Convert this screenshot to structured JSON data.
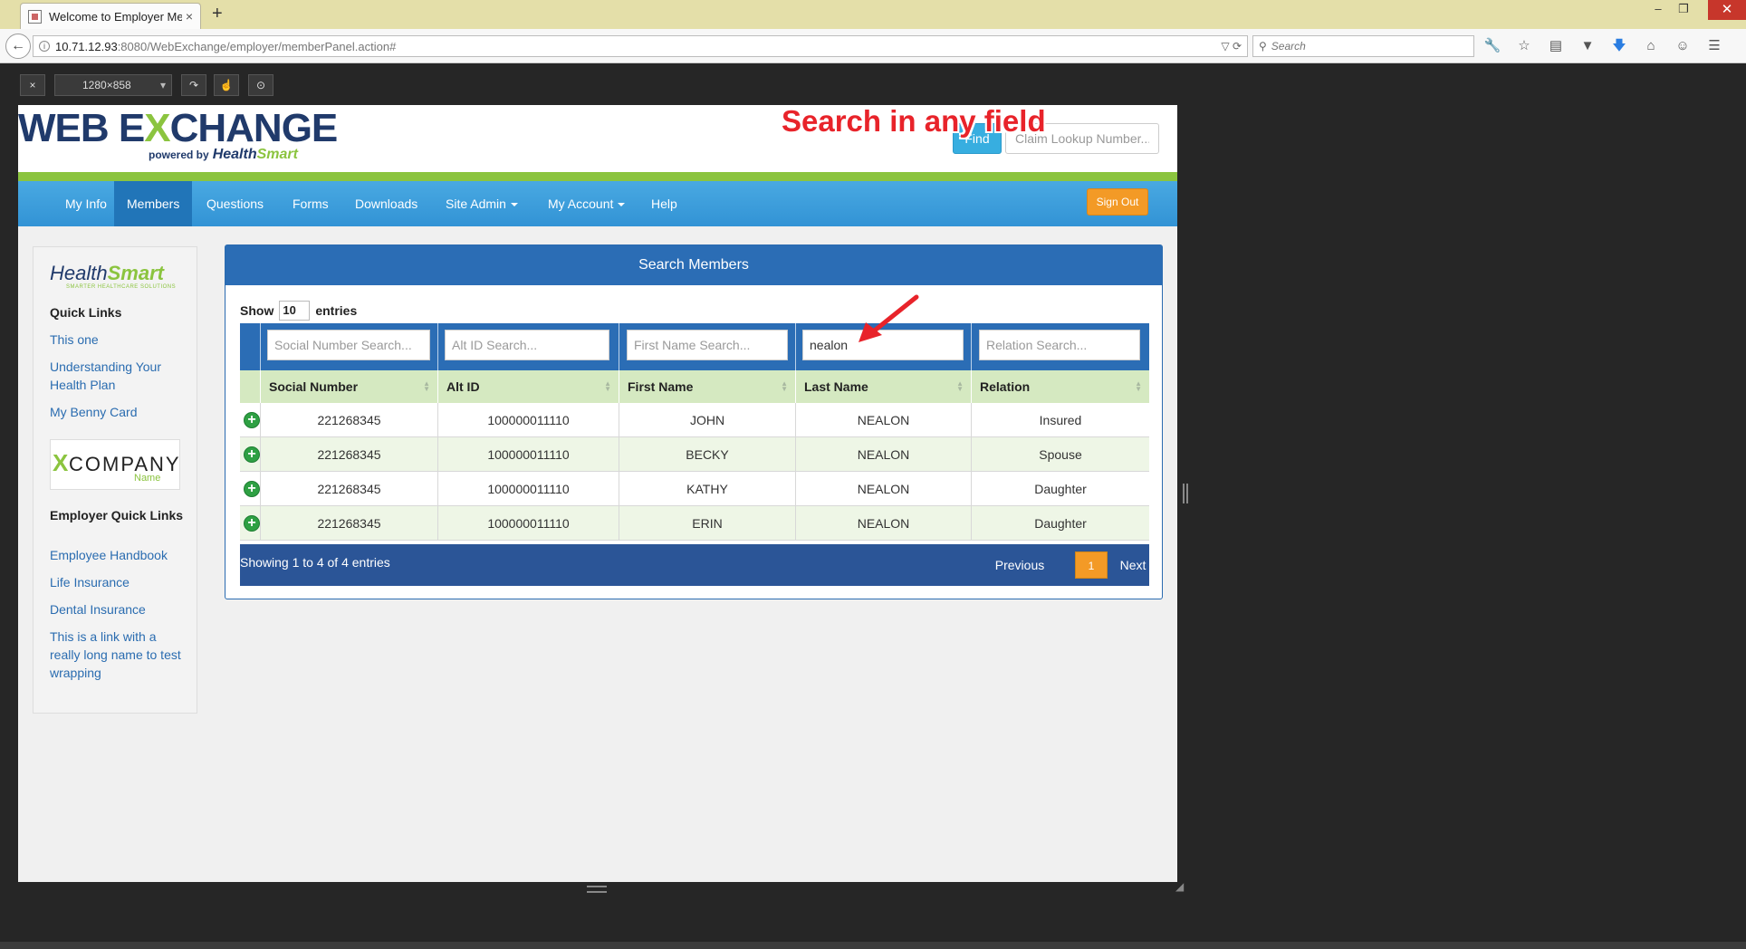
{
  "browser": {
    "tab_title": "Welcome to Employer Me...",
    "new_tab": "+",
    "tab_close": "×",
    "url_host": "10.71.12.93",
    "url_rest": ":8080/WebExchange/employer/memberPanel.action#",
    "search_placeholder": "Search",
    "back": "←",
    "win_min": "–",
    "win_restore": "❐",
    "win_close": "✕",
    "url_icons": "▽ ⟳"
  },
  "rdm": {
    "close": "×",
    "size": "1280×858",
    "rotate": "↷",
    "touch": "☝",
    "screenshot": "⊙"
  },
  "header": {
    "logo_web": "WEB E",
    "logo_x": "X",
    "logo_change": "CHANGE",
    "logo_powered": "powered by",
    "logo_health": "Health",
    "logo_smart": "Smart",
    "find_label": "Find",
    "claim_placeholder": "Claim Lookup Number..."
  },
  "nav": {
    "items": [
      "My Info",
      "Members",
      "Questions",
      "Forms",
      "Downloads",
      "Site Admin",
      "My Account",
      "Help"
    ],
    "sign_out": "Sign Out"
  },
  "sidebar": {
    "logo_health": "Health",
    "logo_smart": "Smart",
    "logo_tagline": "SMARTER HEALTHCARE SOLUTIONS",
    "quick_links_title": "Quick Links",
    "quick_links": [
      "This one",
      "Understanding Your Health Plan",
      "My Benny Card"
    ],
    "company_x": "X",
    "company_text": "COMPANY",
    "company_name": "Name",
    "employer_title": "Employer Quick Links",
    "employer_links": [
      "Employee Handbook",
      "Life Insurance",
      "Dental Insurance",
      "This is a link with a really long name to test wrapping"
    ]
  },
  "panel": {
    "title": "Search Members",
    "show": "Show",
    "length": "10",
    "entries": "entries",
    "filters": [
      {
        "placeholder": "Social Number Search...",
        "value": ""
      },
      {
        "placeholder": "Alt ID Search...",
        "value": ""
      },
      {
        "placeholder": "First Name Search...",
        "value": ""
      },
      {
        "placeholder": "Last Name Search...",
        "value": "nealon"
      },
      {
        "placeholder": "Relation Search...",
        "value": ""
      }
    ],
    "columns": [
      "Social Number",
      "Alt ID",
      "First Name",
      "Last Name",
      "Relation"
    ],
    "rows": [
      [
        "221268345",
        "100000011110",
        "JOHN",
        "NEALON",
        "Insured"
      ],
      [
        "221268345",
        "100000011110",
        "BECKY",
        "NEALON",
        "Spouse"
      ],
      [
        "221268345",
        "100000011110",
        "KATHY",
        "NEALON",
        "Daughter"
      ],
      [
        "221268345",
        "100000011110",
        "ERIN",
        "NEALON",
        "Daughter"
      ]
    ],
    "showing": "Showing 1 to 4 of 4 entries",
    "previous": "Previous",
    "page": "1",
    "next": "Next"
  },
  "annotation": "Search in any field",
  "colors": {
    "nav_blue": "#3293d5",
    "green_bar": "#8bc43f",
    "panel_blue": "#2b6db5",
    "orange": "#f39a26",
    "annotation_red": "#e8232a"
  }
}
